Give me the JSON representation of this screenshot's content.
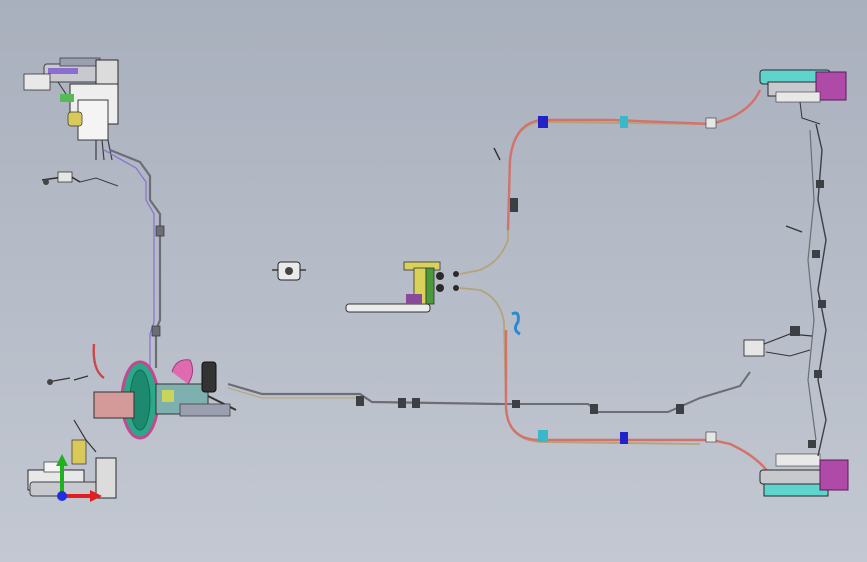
{
  "viewport": {
    "background_top": "#a9b0bd",
    "background_bottom": "#c3c8d2"
  },
  "colors": {
    "hard_line": "#6b6e73",
    "hard_line_dark": "#3c3f44",
    "hose_red": "#d2736b",
    "hose_red_dark": "#9e4c48",
    "hose_tan": "#b5a37a",
    "disc_teal": "#5fd4cc",
    "caliper_magenta": "#b04aa8",
    "booster_teal": "#2aa888",
    "booster_rim": "#c2488f",
    "clip_blue": "#2222c8",
    "clip_cyan": "#38b8c8",
    "bracket_yellow": "#d8d25a",
    "bracket_green": "#4a9a3a",
    "handbrake_purple": "#8a4a9a",
    "axis_x": "#e02020",
    "axis_y": "#20b020",
    "axis_z": "#2030e0"
  },
  "icons": {
    "triad": "coordinate-triad-icon"
  }
}
